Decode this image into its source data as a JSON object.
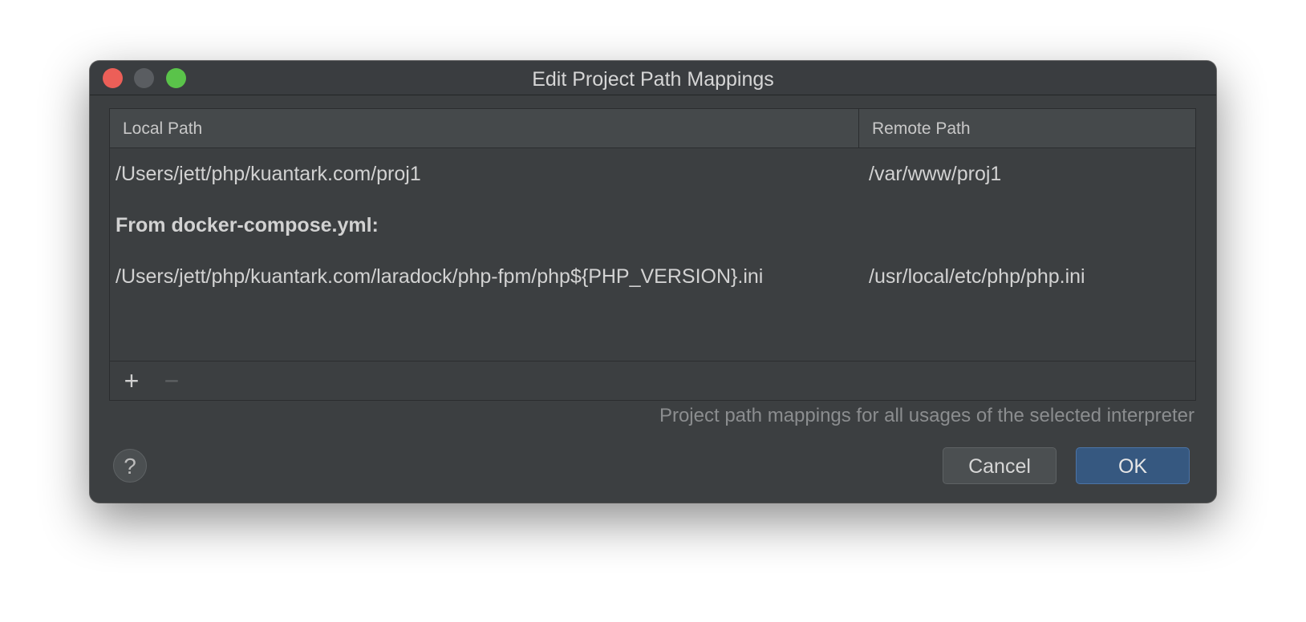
{
  "window": {
    "title": "Edit Project Path Mappings"
  },
  "table": {
    "columns": {
      "local": "Local Path",
      "remote": "Remote Path"
    },
    "rows": [
      {
        "local": "/Users/jett/php/kuantark.com/proj1",
        "remote": "/var/www/proj1"
      }
    ],
    "group_label": "From docker-compose.yml:",
    "group_rows": [
      {
        "local": "/Users/jett/php/kuantark.com/laradock/php-fpm/php${PHP_VERSION}.ini",
        "remote": "/usr/local/etc/php/php.ini"
      }
    ]
  },
  "toolbar": {
    "add_symbol": "+",
    "remove_symbol": "−",
    "add_icon": "plus-icon",
    "remove_icon": "minus-icon"
  },
  "hint": "Project path mappings for all usages of the selected interpreter",
  "buttons": {
    "help": "?",
    "cancel": "Cancel",
    "ok": "OK"
  },
  "colors": {
    "dialog_bg": "#3c3f41",
    "ok_accent": "#365880",
    "close": "#ec5f58",
    "maximize": "#5ac34a"
  }
}
